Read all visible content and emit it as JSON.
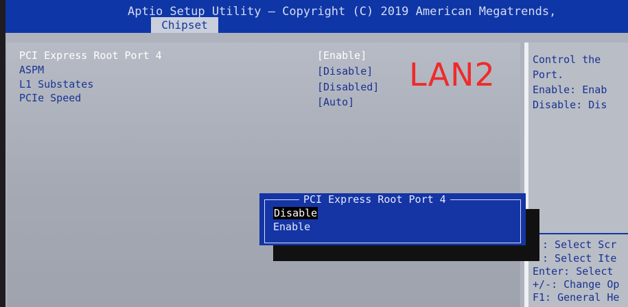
{
  "header": {
    "title": "Aptio Setup Utility – Copyright (C) 2019 American Megatrends,",
    "active_tab": "Chipset"
  },
  "settings": [
    {
      "label": "PCI Express Root Port 4",
      "value": "[Enable]",
      "selected": true
    },
    {
      "label": "ASPM",
      "value": "[Disable]",
      "selected": false
    },
    {
      "label": "L1 Substates",
      "value": "[Disabled]",
      "selected": false
    },
    {
      "label": "PCIe Speed",
      "value": "[Auto]",
      "selected": false
    }
  ],
  "annotation": "LAN2",
  "help": {
    "description": [
      "Control the",
      "Port.",
      "Enable: Enab",
      "Disable: Dis"
    ],
    "keys": [
      ": Select Scr",
      ": Select Ite",
      "Enter: Select",
      "+/-: Change Op",
      "F1: General He"
    ]
  },
  "popup": {
    "title": "PCI Express Root Port 4",
    "options": [
      {
        "label": "Disable",
        "selected": true
      },
      {
        "label": "Enable",
        "selected": false
      }
    ]
  },
  "colors": {
    "header_blue": "#0f36a6",
    "text_blue": "#1a3493",
    "body_gray": "#aeb2bc",
    "annotation_red": "#ee2b2b"
  }
}
